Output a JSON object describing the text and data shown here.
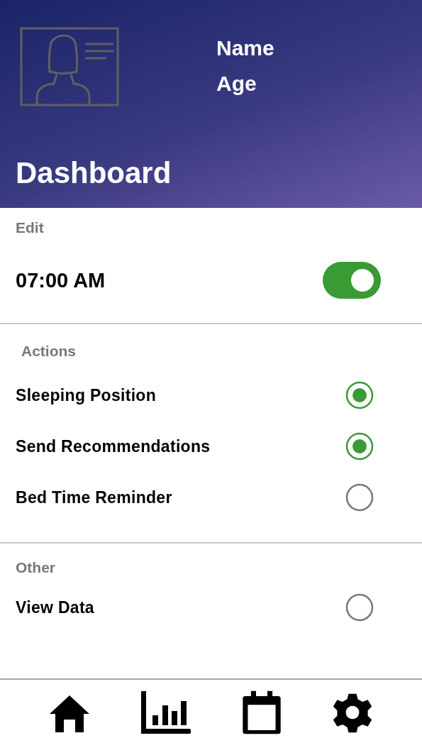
{
  "header": {
    "name_label": "Name",
    "age_label": "Age",
    "title": "Dashboard"
  },
  "edit": {
    "label": "Edit",
    "time": "07:00 AM",
    "on": true
  },
  "actions": {
    "label": "Actions",
    "items": [
      {
        "label": "Sleeping Position",
        "checked": true
      },
      {
        "label": "Send Recommendations",
        "checked": true
      },
      {
        "label": "Bed Time Reminder",
        "checked": false
      }
    ]
  },
  "other": {
    "label": "Other",
    "items": [
      {
        "label": "View Data",
        "checked": false
      }
    ]
  },
  "nav": [
    {
      "kind": "home"
    },
    {
      "kind": "chart"
    },
    {
      "kind": "calendar"
    },
    {
      "kind": "settings"
    }
  ]
}
